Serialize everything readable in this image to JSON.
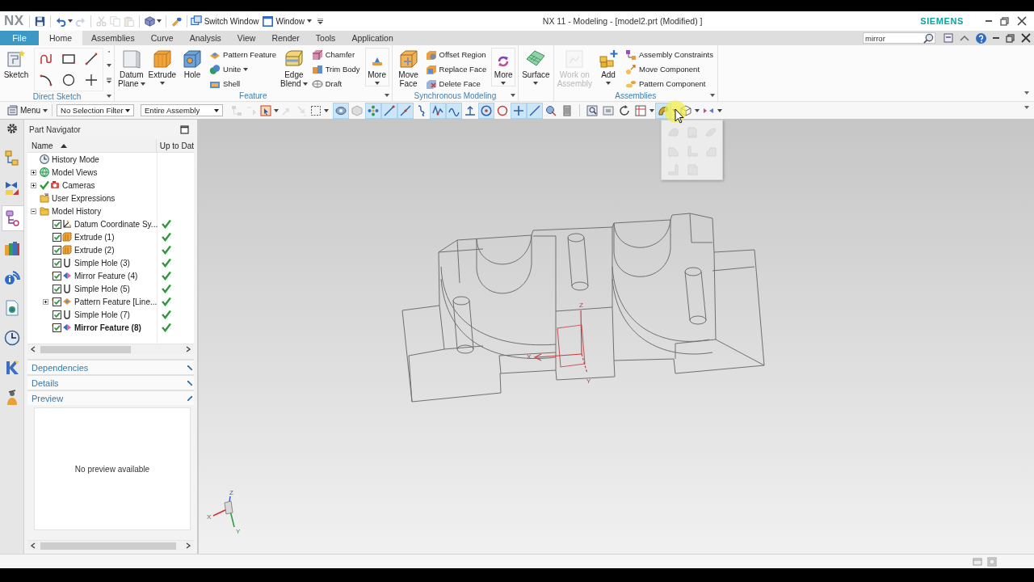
{
  "title_bar": {
    "logo": "NX",
    "quick_access": [
      {
        "disabled": false
      },
      {
        "disabled": false
      },
      {
        "disabled": true
      },
      {
        "disabled": true
      },
      {
        "disabled": true
      },
      {
        "disabled": true
      },
      {
        "disabled": false
      },
      {
        "disabled": false
      }
    ],
    "switch_window": "Switch Window",
    "window_menu": "Window",
    "title": "NX 11 - Modeling - [model2.prt (Modified) ]",
    "brand": "SIEMENS"
  },
  "ribbon_tabs": {
    "file": "File",
    "tabs": [
      {
        "label": "Home",
        "selected": true
      },
      {
        "label": "Assemblies",
        "selected": false
      },
      {
        "label": "Curve",
        "selected": false
      },
      {
        "label": "Analysis",
        "selected": false
      },
      {
        "label": "View",
        "selected": false
      },
      {
        "label": "Render",
        "selected": false
      },
      {
        "label": "Tools",
        "selected": false
      },
      {
        "label": "Application",
        "selected": false
      }
    ],
    "search": {
      "value": "mirror"
    }
  },
  "ribbon": {
    "groups": [
      {
        "label": "Direct Sketch",
        "items": [
          {
            "kind": "large",
            "label": "Sketch",
            "menu": false
          },
          {
            "kind": "gallery"
          }
        ]
      },
      {
        "label": "Feature",
        "items": [
          {
            "kind": "large",
            "label": "Datum Plane",
            "menu": true
          },
          {
            "kind": "large",
            "label": "Extrude",
            "menu": true
          },
          {
            "kind": "large",
            "label": "Hole",
            "menu": false
          },
          {
            "kind": "stack",
            "buttons": [
              {
                "label": "Pattern Feature",
                "menu": false
              },
              {
                "label": "Unite",
                "menu": true
              },
              {
                "label": "Shell",
                "menu": false
              }
            ]
          },
          {
            "kind": "large",
            "label": "Edge Blend",
            "menu": true
          },
          {
            "kind": "stack",
            "buttons": [
              {
                "label": "Chamfer",
                "menu": false
              },
              {
                "label": "Trim Body",
                "menu": false
              },
              {
                "label": "Draft",
                "menu": false
              }
            ]
          },
          {
            "kind": "more",
            "label": "More"
          }
        ]
      },
      {
        "label": "Synchronous Modeling",
        "items": [
          {
            "kind": "large",
            "label": "Move Face",
            "menu": false
          },
          {
            "kind": "stack",
            "buttons": [
              {
                "label": "Offset Region",
                "menu": false
              },
              {
                "label": "Replace Face",
                "menu": false
              },
              {
                "label": "Delete Face",
                "menu": false
              }
            ]
          },
          {
            "kind": "more",
            "label": "More"
          }
        ]
      },
      {
        "items": [
          {
            "kind": "large",
            "label": "Surface",
            "menu": true
          }
        ]
      },
      {
        "label": "Assemblies",
        "items": [
          {
            "kind": "large",
            "label": "Work on Assembly",
            "menu": false,
            "disabled": true
          },
          {
            "kind": "large",
            "label": "Add",
            "menu": true,
            "disabled": false
          },
          {
            "kind": "stack",
            "buttons": [
              {
                "label": "Assembly Constraints",
                "menu": false
              },
              {
                "label": "Move Component",
                "menu": false
              },
              {
                "label": "Pattern Component",
                "menu": false
              }
            ]
          }
        ]
      }
    ]
  },
  "selection_bar": {
    "menu": "Menu",
    "filter": "No Selection Filter",
    "scope": "Entire Assembly",
    "tools": [
      {
        "disabled": true
      },
      {
        "disabled": true
      },
      {
        "disabled": false
      },
      {
        "disabled": true
      },
      {
        "disabled": true
      },
      {
        "disabled": false
      }
    ],
    "snap_points": [
      {
        "on": true
      },
      {
        "on": false
      },
      {
        "on": true
      },
      {
        "on": true
      },
      {
        "on": true
      },
      {
        "on": false
      },
      {
        "on": true
      },
      {
        "on": true
      },
      {
        "on": false
      },
      {
        "on": true
      },
      {
        "on": false
      },
      {
        "on": true
      },
      {
        "on": true
      },
      {
        "on": false
      },
      {
        "on": false
      }
    ],
    "view_tools": [
      {
        "on": false
      },
      {
        "on": false
      },
      {
        "on": false
      },
      {
        "on": false
      },
      {
        "on": true
      },
      {
        "on": false
      },
      {
        "on": false
      }
    ]
  },
  "orientation_menu": {
    "items": [
      {
        "disabled": true
      },
      {
        "disabled": true
      },
      {
        "disabled": true
      },
      {
        "disabled": true
      },
      {
        "disabled": true
      },
      {
        "disabled": true
      },
      {
        "disabled": true
      },
      {
        "disabled": true
      }
    ]
  },
  "resource_bar": {
    "tabs": [
      {
        "selected": false
      },
      {
        "selected": false
      },
      {
        "selected": true
      },
      {
        "selected": false
      },
      {
        "selected": false
      },
      {
        "selected": false
      },
      {
        "selected": false
      },
      {
        "selected": false
      },
      {
        "selected": false
      }
    ]
  },
  "part_navigator": {
    "title": "Part Navigator",
    "columns": [
      {
        "label": "Name",
        "sorted": true
      },
      {
        "label": "Up to Dat",
        "sorted": false
      }
    ],
    "tree": [
      {
        "label": "History Mode",
        "kind": "mode"
      },
      {
        "label": "Model Views",
        "kind": "views",
        "expanded": false
      },
      {
        "label": "Cameras",
        "kind": "cameras",
        "expanded": false,
        "shown": true
      },
      {
        "label": "User Expressions",
        "kind": "expressions"
      },
      {
        "label": "Model History",
        "kind": "folder",
        "expanded": true,
        "children": [
          {
            "label": "Datum Coordinate Sy...",
            "kind": "datum",
            "checked": true,
            "up_to_date": true,
            "current": false
          },
          {
            "label": "Extrude (1)",
            "kind": "extrude",
            "checked": true,
            "up_to_date": true,
            "current": false
          },
          {
            "label": "Extrude (2)",
            "kind": "extrude",
            "checked": true,
            "up_to_date": true,
            "current": false
          },
          {
            "label": "Simple Hole (3)",
            "kind": "hole",
            "checked": true,
            "up_to_date": true,
            "current": false
          },
          {
            "label": "Mirror Feature (4)",
            "kind": "mirror",
            "checked": true,
            "up_to_date": true,
            "current": false
          },
          {
            "label": "Simple Hole (5)",
            "kind": "hole",
            "checked": true,
            "up_to_date": true,
            "current": false
          },
          {
            "label": "Pattern Feature [Line...",
            "kind": "pattern",
            "expanded": false,
            "checked": true,
            "up_to_date": true,
            "current": false
          },
          {
            "label": "Simple Hole (7)",
            "kind": "hole",
            "checked": true,
            "up_to_date": true,
            "current": false
          },
          {
            "label": "Mirror Feature (8)",
            "kind": "mirror",
            "checked": true,
            "up_to_date": true,
            "current": true
          }
        ]
      }
    ],
    "sections": [
      {
        "label": "Dependencies",
        "expanded": false
      },
      {
        "label": "Details",
        "expanded": false
      },
      {
        "label": "Preview",
        "expanded": true
      }
    ],
    "preview_message": "No preview available"
  },
  "graphics": {
    "wcs": {
      "x": "X",
      "y": "Y",
      "z": "Z"
    },
    "triad": {
      "x": "X",
      "y": "Y",
      "z": "Z"
    }
  }
}
